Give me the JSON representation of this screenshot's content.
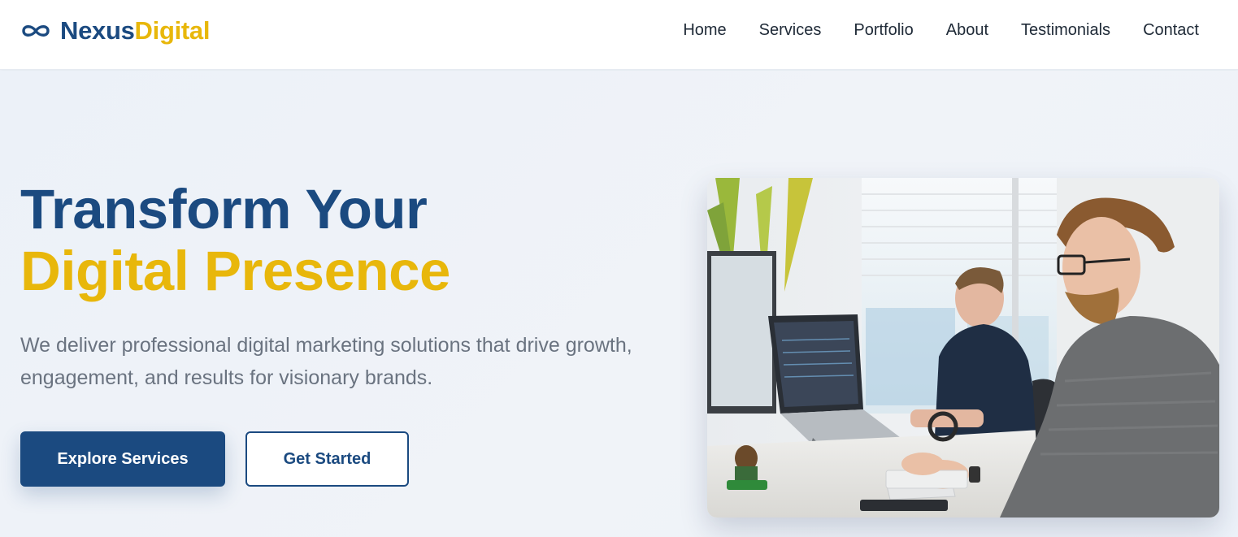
{
  "brand": {
    "name_part1": "Nexus",
    "name_part2": "Digital",
    "icon": "infinity-icon",
    "primary_color": "#1b4a80",
    "accent_color": "#e8b70b"
  },
  "nav": {
    "items": [
      {
        "label": "Home"
      },
      {
        "label": "Services"
      },
      {
        "label": "Portfolio"
      },
      {
        "label": "About"
      },
      {
        "label": "Testimonials"
      },
      {
        "label": "Contact"
      }
    ]
  },
  "hero": {
    "title_line1": "Transform Your",
    "title_line2": "Digital Presence",
    "subtitle": "We deliver professional digital marketing solutions that drive growth, engagement, and results for visionary brands.",
    "primary_button": "Explore Services",
    "secondary_button": "Get Started",
    "image_alt": "Two men working at computers in a bright office"
  }
}
